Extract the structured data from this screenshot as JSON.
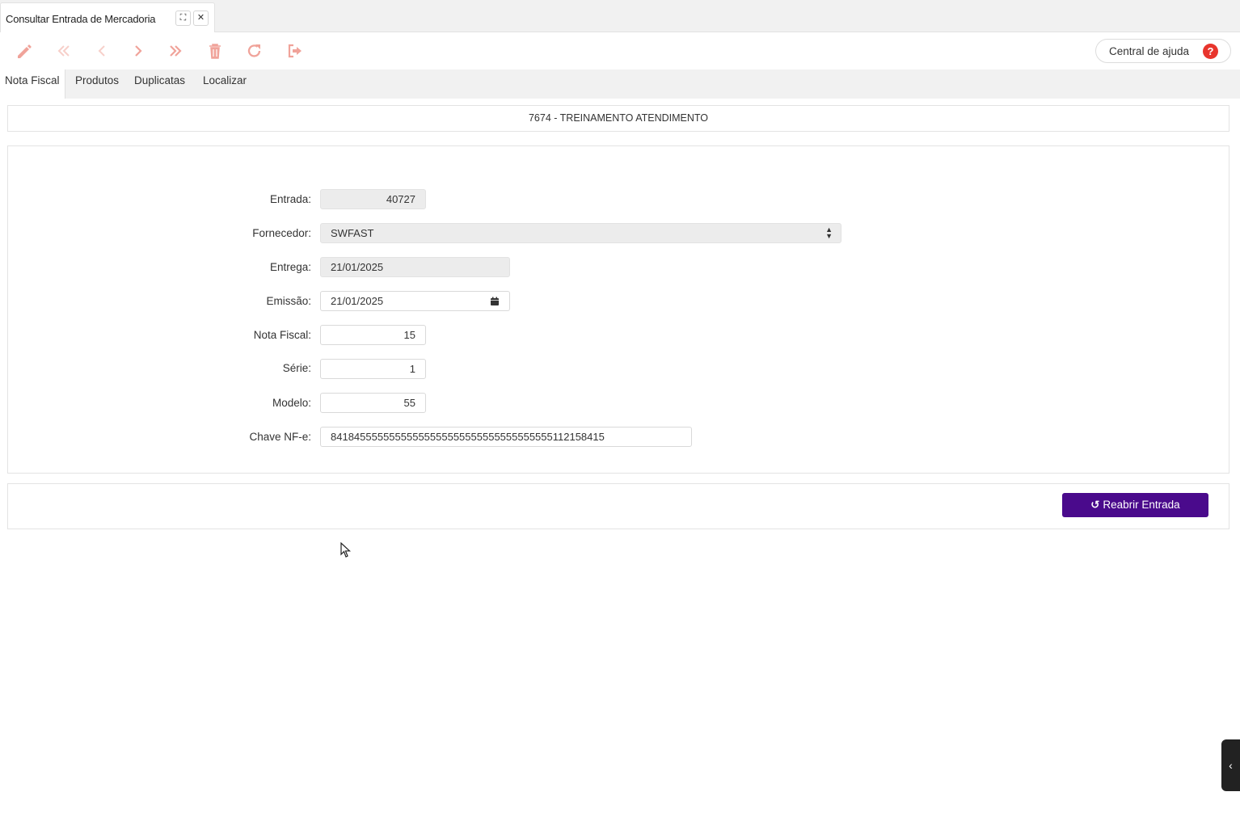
{
  "window_tab": {
    "title": "Consultar Entrada de Mercadoria",
    "expand_glyph": "⛶",
    "close_glyph": "✕"
  },
  "toolbar": {
    "icons": [
      "pencil-icon",
      "first-record-icon",
      "previous-record-icon",
      "next-record-icon",
      "last-record-icon",
      "trash-icon",
      "refresh-icon",
      "exit-icon"
    ],
    "icon_color": "#f0a39a",
    "help_label": "Central de ajuda",
    "help_glyph": "?"
  },
  "nav": {
    "tabs": [
      {
        "label": "Nota Fiscal",
        "active": true
      },
      {
        "label": "Produtos",
        "active": false
      },
      {
        "label": "Duplicatas",
        "active": false
      },
      {
        "label": "Localizar",
        "active": false
      }
    ]
  },
  "header": {
    "company": "7674 - TREINAMENTO ATENDIMENTO"
  },
  "form": {
    "entrada": {
      "label": "Entrada:",
      "value": "40727"
    },
    "fornecedor": {
      "label": "Fornecedor:",
      "value": "SWFAST"
    },
    "entrega": {
      "label": "Entrega:",
      "value": "21/01/2025"
    },
    "emissao": {
      "label": "Emissão:",
      "value": "21/01/2025"
    },
    "nota_fiscal": {
      "label": "Nota Fiscal:",
      "value": "15"
    },
    "serie": {
      "label": "Série:",
      "value": "1"
    },
    "modelo": {
      "label": "Modelo:",
      "value": "55"
    },
    "chave_nfe": {
      "label": "Chave NF-e:",
      "value": "84184555555555555555555555555555555555112158415"
    }
  },
  "actions": {
    "reopen_label": "Reabrir Entrada",
    "reopen_color": "#4a0a8c"
  },
  "side_panel": {
    "toggle_glyph": "‹"
  }
}
